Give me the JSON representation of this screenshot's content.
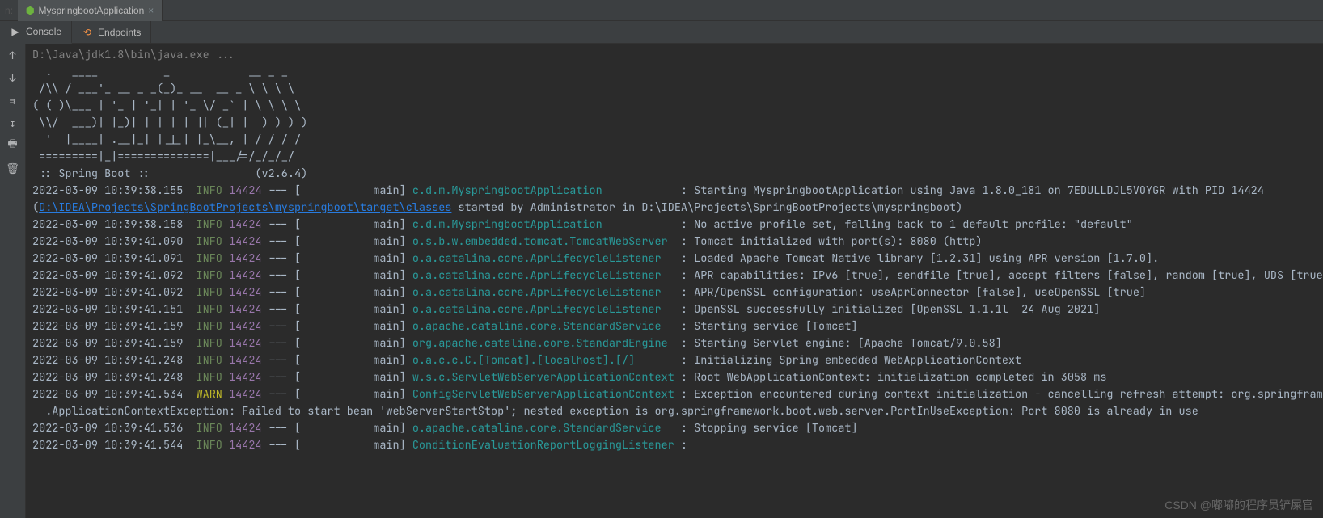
{
  "tab": {
    "title": "MyspringbootApplication",
    "close": "×"
  },
  "prefix": {
    "label": "n:"
  },
  "subtabs": {
    "console": {
      "label": "Console",
      "icon": "▶"
    },
    "endpoints": {
      "label": "Endpoints",
      "icon": "⟲"
    }
  },
  "gutter": {
    "up": "↑",
    "down": "↓",
    "wrap": "⇉",
    "scroll": "↧",
    "print": "🖶",
    "trash": "🗑"
  },
  "cmdline": "D:\\Java\\jdk1.8\\bin\\java.exe ...",
  "banner": [
    "  .   ____          _            __ _ _",
    " /\\\\ / ___'_ __ _ _(_)_ __  __ _ \\ \\ \\ \\",
    "( ( )\\___ | '_ | '_| | '_ \\/ _` | \\ \\ \\ \\",
    " \\\\/  ___)| |_)| | | | | || (_| |  ) ) ) )",
    "  '  |____| .__|_| |_|_| |_\\__, | / / / /",
    " =========|_|==============|___/=/_/_/_/",
    " :: Spring Boot ::                (v2.6.4)"
  ],
  "link_path": "D:\\IDEA\\Projects\\SpringBootProjects\\myspringboot\\target\\classes",
  "logs": [
    {
      "ts": "2022-03-09 10:39:38.155",
      "lvl": "INFO",
      "pid": "14424",
      "sep": "--- [",
      "thread": "           main]",
      "logger": "c.d.m.MyspringbootApplication           ",
      "msg": ": Starting MyspringbootApplication using Java 1.8.0_181 on 7EDULLDJL5VOYGR with PID 14424 "
    },
    {
      "raw_prefix": "(",
      "raw_suffix": " started by Administrator in D:\\IDEA\\Projects\\SpringBootProjects\\myspringboot)"
    },
    {
      "ts": "2022-03-09 10:39:38.158",
      "lvl": "INFO",
      "pid": "14424",
      "sep": "--- [",
      "thread": "           main]",
      "logger": "c.d.m.MyspringbootApplication           ",
      "msg": ": No active profile set, falling back to 1 default profile: \"default\""
    },
    {
      "ts": "2022-03-09 10:39:41.090",
      "lvl": "INFO",
      "pid": "14424",
      "sep": "--- [",
      "thread": "           main]",
      "logger": "o.s.b.w.embedded.tomcat.TomcatWebServer ",
      "msg": ": Tomcat initialized with port(s): 8080 (http)"
    },
    {
      "ts": "2022-03-09 10:39:41.091",
      "lvl": "INFO",
      "pid": "14424",
      "sep": "--- [",
      "thread": "           main]",
      "logger": "o.a.catalina.core.AprLifecycleListener  ",
      "msg": ": Loaded Apache Tomcat Native library [1.2.31] using APR version [1.7.0]."
    },
    {
      "ts": "2022-03-09 10:39:41.092",
      "lvl": "INFO",
      "pid": "14424",
      "sep": "--- [",
      "thread": "           main]",
      "logger": "o.a.catalina.core.AprLifecycleListener  ",
      "msg": ": APR capabilities: IPv6 [true], sendfile [true], accept filters [false], random [true], UDS [true]."
    },
    {
      "ts": "2022-03-09 10:39:41.092",
      "lvl": "INFO",
      "pid": "14424",
      "sep": "--- [",
      "thread": "           main]",
      "logger": "o.a.catalina.core.AprLifecycleListener  ",
      "msg": ": APR/OpenSSL configuration: useAprConnector [false], useOpenSSL [true]"
    },
    {
      "ts": "2022-03-09 10:39:41.151",
      "lvl": "INFO",
      "pid": "14424",
      "sep": "--- [",
      "thread": "           main]",
      "logger": "o.a.catalina.core.AprLifecycleListener  ",
      "msg": ": OpenSSL successfully initialized [OpenSSL 1.1.1l  24 Aug 2021]"
    },
    {
      "ts": "2022-03-09 10:39:41.159",
      "lvl": "INFO",
      "pid": "14424",
      "sep": "--- [",
      "thread": "           main]",
      "logger": "o.apache.catalina.core.StandardService  ",
      "msg": ": Starting service [Tomcat]"
    },
    {
      "ts": "2022-03-09 10:39:41.159",
      "lvl": "INFO",
      "pid": "14424",
      "sep": "--- [",
      "thread": "           main]",
      "logger": "org.apache.catalina.core.StandardEngine ",
      "msg": ": Starting Servlet engine: [Apache Tomcat/9.0.58]"
    },
    {
      "ts": "2022-03-09 10:39:41.248",
      "lvl": "INFO",
      "pid": "14424",
      "sep": "--- [",
      "thread": "           main]",
      "logger": "o.a.c.c.C.[Tomcat].[localhost].[/]      ",
      "msg": ": Initializing Spring embedded WebApplicationContext"
    },
    {
      "ts": "2022-03-09 10:39:41.248",
      "lvl": "INFO",
      "pid": "14424",
      "sep": "--- [",
      "thread": "           main]",
      "logger": "w.s.c.ServletWebServerApplicationContext",
      "msg": ": Root WebApplicationContext: initialization completed in 3058 ms"
    },
    {
      "ts": "2022-03-09 10:39:41.534",
      "lvl": "WARN",
      "pid": "14424",
      "sep": "--- [",
      "thread": "           main]",
      "logger": "ConfigServletWebServerApplicationContext",
      "msg": ": Exception encountered during context initialization - cancelling refresh attempt: org.springframew"
    },
    {
      "plain": "  .ApplicationContextException: Failed to start bean 'webServerStartStop'; nested exception is org.springframework.boot.web.server.PortInUseException: Port 8080 is already in use"
    },
    {
      "ts": "2022-03-09 10:39:41.536",
      "lvl": "INFO",
      "pid": "14424",
      "sep": "--- [",
      "thread": "           main]",
      "logger": "o.apache.catalina.core.StandardService  ",
      "msg": ": Stopping service [Tomcat]"
    },
    {
      "ts": "2022-03-09 10:39:41.544",
      "lvl": "INFO",
      "pid": "14424",
      "sep": "--- [",
      "thread": "           main]",
      "logger": "ConditionEvaluationReportLoggingListener",
      "msg": ":"
    }
  ],
  "watermark": "CSDN @嘟嘟的程序员铲屎官"
}
